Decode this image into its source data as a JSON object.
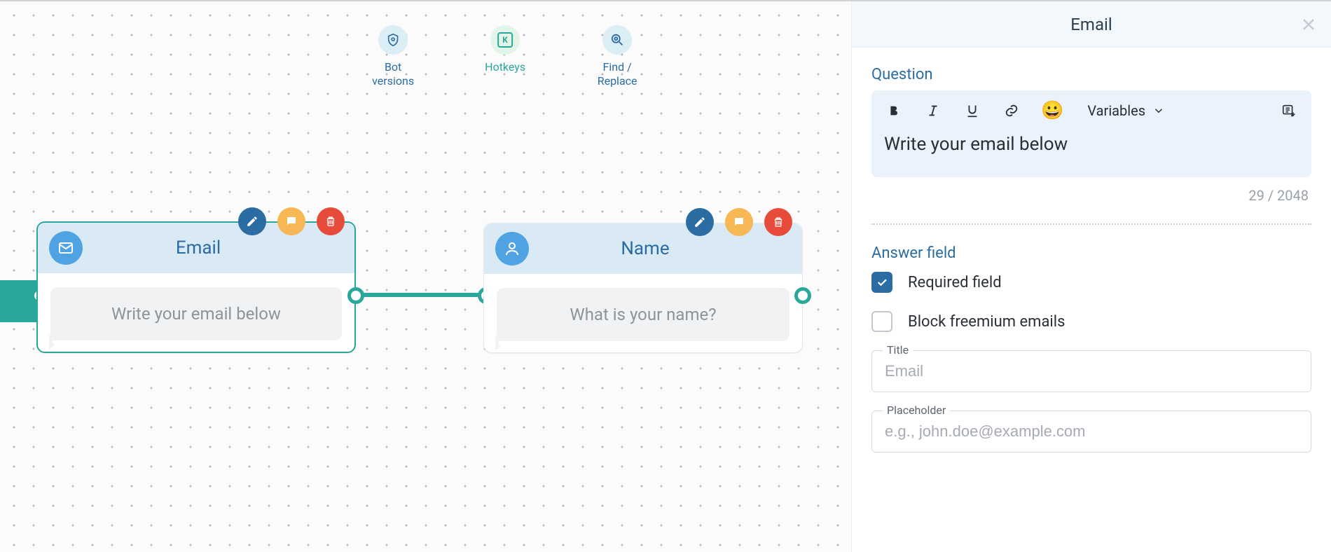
{
  "toolbar": {
    "bot_versions": "Bot versions",
    "hotkeys": "Hotkeys",
    "find_replace": "Find / Replace",
    "k_glyph": "K"
  },
  "nodes": {
    "email": {
      "title": "Email",
      "message": "Write your email below"
    },
    "name": {
      "title": "Name",
      "message": "What is your name?"
    }
  },
  "panel": {
    "title": "Email",
    "question_label": "Question",
    "editor_text": "Write your email below",
    "variables_label": "Variables",
    "counter": "29 / 2048",
    "answer_label": "Answer field",
    "required_label": "Required field",
    "block_freemium_label": "Block freemium emails",
    "title_field": {
      "label": "Title",
      "placeholder": "Email",
      "value": ""
    },
    "placeholder_field": {
      "label": "Placeholder",
      "placeholder": "e.g., john.doe@example.com",
      "value": ""
    }
  }
}
